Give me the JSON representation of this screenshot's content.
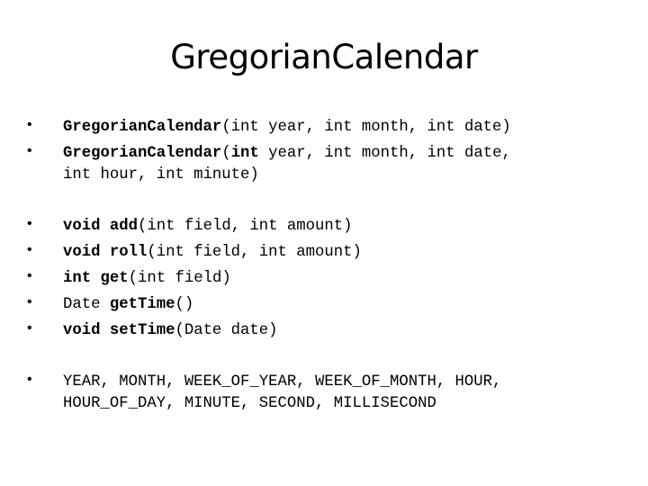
{
  "slide": {
    "title": "GregorianCalendar",
    "bullet_glyph": "•",
    "constructors": [
      {
        "name": "GregorianCalendar",
        "params_line1": "(int year, int month, int date)"
      },
      {
        "name": "GregorianCalendar",
        "open": "(",
        "bold_int": "int",
        "rest_line1": " year, int month, int date,",
        "line2": "int hour, int minute)"
      }
    ],
    "methods": [
      {
        "ret": "void ",
        "name": "add",
        "params": "(int field, int amount)",
        "ret_bold": true
      },
      {
        "ret": "void ",
        "name": "roll",
        "params": "(int field, int amount)",
        "ret_bold": true
      },
      {
        "ret": "int ",
        "name": "get",
        "params": "(int field)",
        "ret_bold": true
      },
      {
        "ret": "Date ",
        "name": "getTime",
        "params": "()",
        "ret_bold": false
      },
      {
        "ret": "void ",
        "name": "setTime",
        "params": "(Date date)",
        "ret_bold": true
      }
    ],
    "fields": {
      "line1": "YEAR, MONTH, WEEK_OF_YEAR, WEEK_OF_MONTH, HOUR,",
      "line2": "HOUR_OF_DAY, MINUTE, SECOND, MILLISECOND"
    }
  }
}
